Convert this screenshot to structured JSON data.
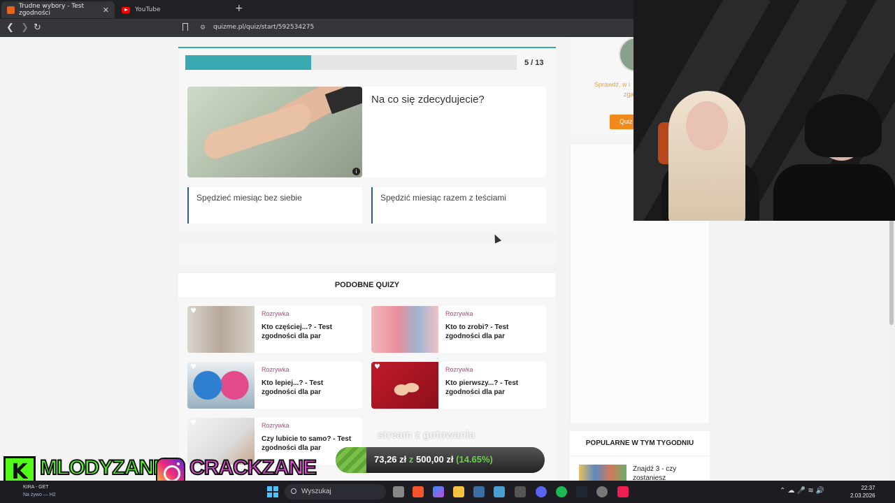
{
  "browser": {
    "tabs": [
      {
        "label": "Trudne wybory - Test zgodności",
        "active": true
      },
      {
        "label": "YouTube",
        "active": false
      }
    ],
    "url": "quizme.pl/quiz/start/592534275",
    "new_tab": "+",
    "close": "✕"
  },
  "quiz": {
    "progress_current": 5,
    "progress_total": 13,
    "progress_label": "5 / 13",
    "progress_fraction": 0.38,
    "question": "Na co się zdecydujecie?",
    "answers": [
      "Spędzieć miesiąc bez siebie",
      "Spędzić miesiąc razem z teściami"
    ],
    "accent_color": "#3aa9b1"
  },
  "similar": {
    "heading": "PODOBNE QUIZY",
    "items": [
      {
        "category": "Rozrywka",
        "title": "Kto częściej...? - Test zgodności dla par"
      },
      {
        "category": "Rozrywka",
        "title": "Kto to zrobi? - Test zgodności dla par"
      },
      {
        "category": "Rozrywka",
        "title": "Kto lepiej...? - Test zgodności dla par"
      },
      {
        "category": "Rozrywka",
        "title": "Kto pierwszy...? - Test zgodności dla par"
      },
      {
        "category": "Rozrywka",
        "title": "Czy lubicie to samo? - Test zgodności dla par"
      }
    ]
  },
  "sidebar": {
    "promo_text_1": "Sprawdź, w i",
    "promo_text_2": "zga",
    "promo_button": "Quiz",
    "popular_heading": "POPULARNE W TYM TYGODNIU",
    "popular_item": "Znajdź 3 - czy zostaniesz"
  },
  "stream": {
    "caption": "stream z gotowania",
    "donation_current": "73,26 zł",
    "donation_sep": "z",
    "donation_goal": "500,00 zł",
    "donation_percent": "(14.65%)",
    "donation_fraction": 0.1465,
    "kick_letter": "K",
    "kick_name": "MLODYZANE",
    "instagram_name": "CRACKZANE"
  },
  "taskbar": {
    "app_name": "KIRA - GET",
    "app_status": "Na żywo — H2",
    "search_placeholder": "Wyszukaj",
    "time": "22:37",
    "date": "2.03.2026"
  }
}
